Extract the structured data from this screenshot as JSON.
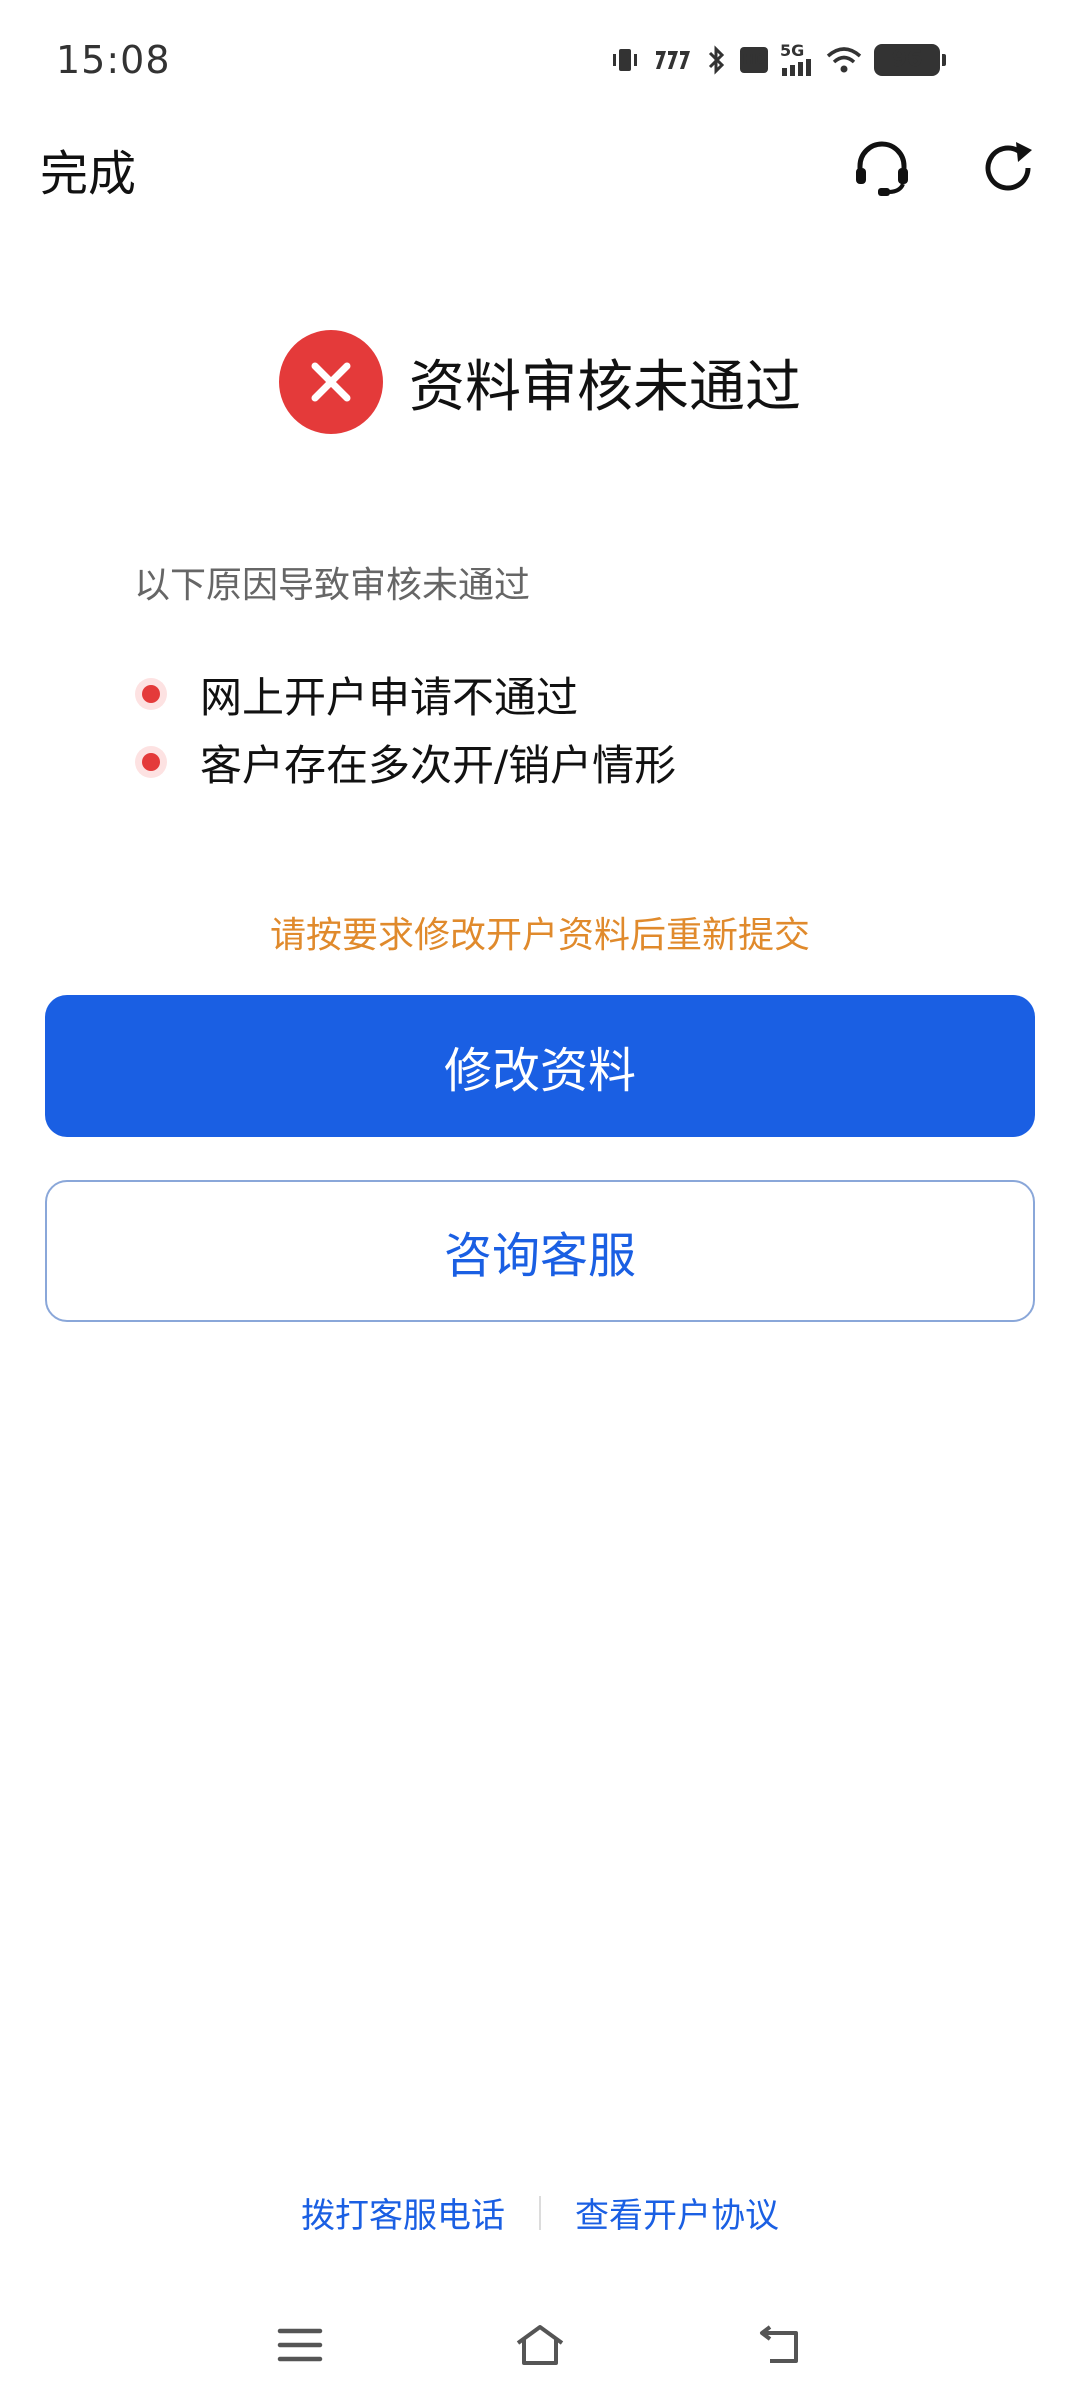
{
  "status_bar": {
    "time": "15:08",
    "battery": "96",
    "network": "5G",
    "hd": "HD",
    "icons": [
      "vibrate-icon",
      "signal-777-icon",
      "bluetooth-icon",
      "hd-icon",
      "5g-signal-icon",
      "wifi-icon",
      "battery-icon"
    ]
  },
  "header": {
    "done_label": "完成",
    "icons": [
      "headset-icon",
      "refresh-icon"
    ]
  },
  "result": {
    "title": "资料审核未通过",
    "status_color": "#e43a3a",
    "icon": "close-icon"
  },
  "reasons": {
    "intro": "以下原因导致审核未通过",
    "items": [
      {
        "text": "网上开户申请不通过"
      },
      {
        "text": "客户存在多次开/销户情形"
      }
    ]
  },
  "hint": "请按要求修改开户资料后重新提交",
  "buttons": {
    "primary_label": "修改资料",
    "secondary_label": "咨询客服",
    "primary_color": "#1a5fe3"
  },
  "footer": {
    "call_link": "拨打客服电话",
    "agreement_link": "查看开户协议"
  },
  "nav": {
    "icons": [
      "menu-icon",
      "home-icon",
      "back-icon"
    ]
  }
}
